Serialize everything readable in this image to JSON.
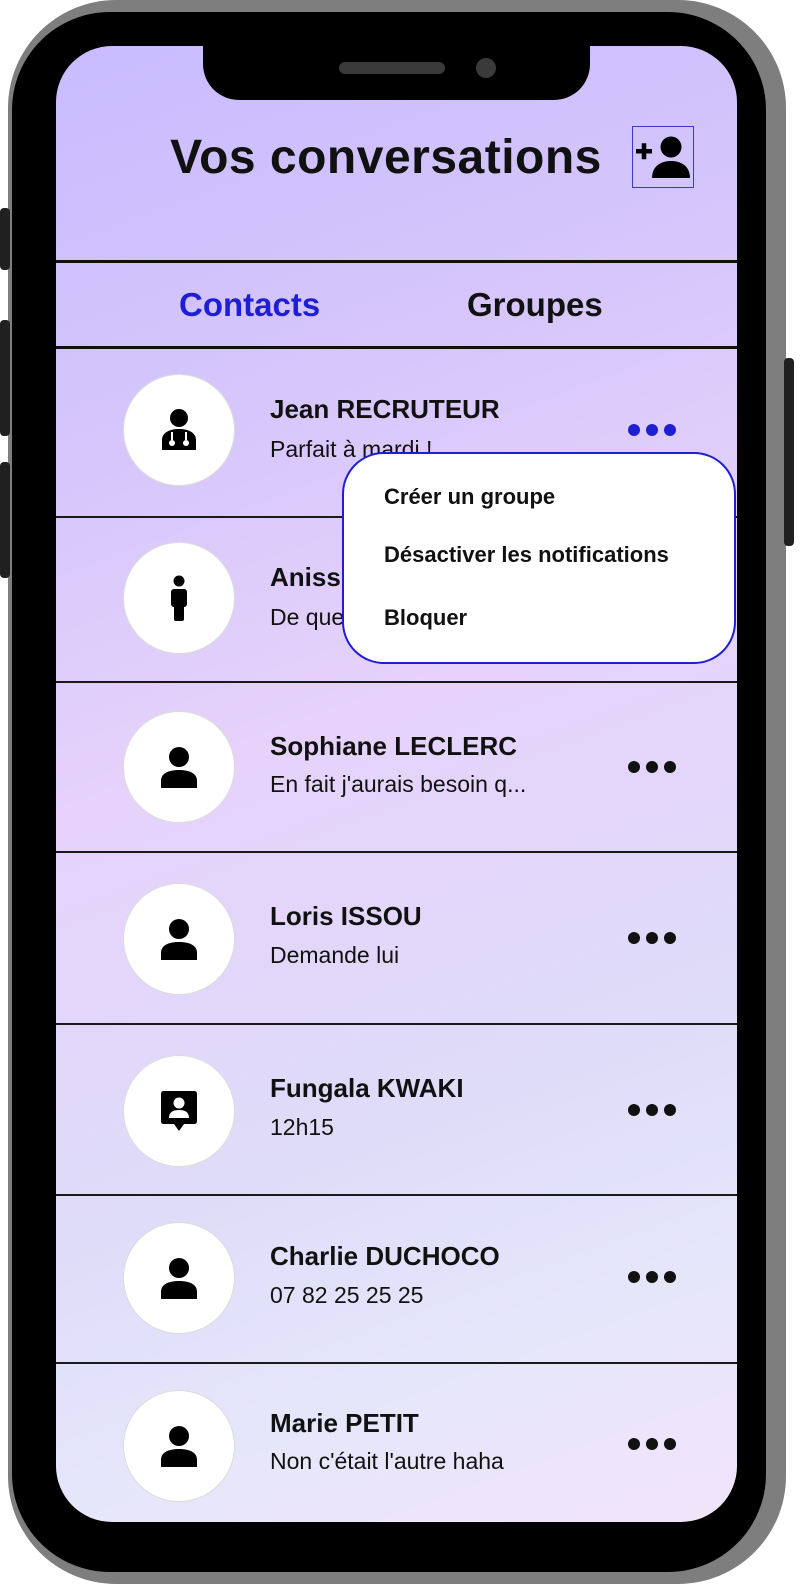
{
  "header": {
    "title": "Vos conversations",
    "add_icon": "add-person-icon"
  },
  "tabs": [
    {
      "label": "Contacts",
      "active": true,
      "color": "#1e1ed2"
    },
    {
      "label": "Groupes",
      "active": false
    }
  ],
  "contacts": [
    {
      "name": "Jean RECRUTEUR",
      "preview": "Parfait à mardi !",
      "icon": "doctor-icon"
    },
    {
      "name": "Aniss",
      "preview": "De que",
      "icon": "standing-person-icon"
    },
    {
      "name": "Sophiane LECLERC",
      "preview": "En fait j'aurais besoin q...",
      "icon": "person-icon"
    },
    {
      "name": "Loris ISSOU",
      "preview": "Demande lui",
      "icon": "person-icon"
    },
    {
      "name": "Fungala KWAKI",
      "preview": "12h15",
      "icon": "contact-card-icon"
    },
    {
      "name": "Charlie DUCHOCO",
      "preview": "07 82 25 25 25",
      "icon": "person-icon"
    },
    {
      "name": "Marie PETIT",
      "preview": "Non c'était l'autre haha",
      "icon": "person-icon"
    }
  ],
  "context_menu": {
    "items": [
      "Créer un groupe",
      "Désactiver les notifications",
      "Bloquer"
    ],
    "border_color": "#1e1ed2"
  }
}
